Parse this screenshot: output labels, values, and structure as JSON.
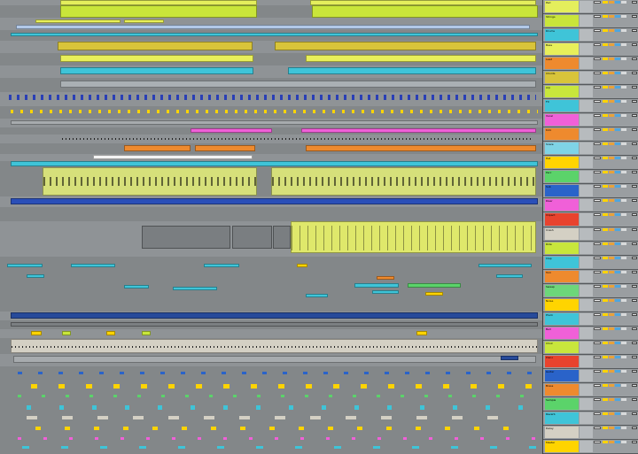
{
  "app": {
    "view": "arrangement",
    "colors": {
      "yellow_green": "#c8e63c",
      "lime": "#e8ef5a",
      "cyan": "#3fc4d8",
      "blue": "#2a63c9",
      "dark_blue": "#274a9a",
      "magenta": "#f060d8",
      "orange": "#ee8a2e",
      "gray_audio": "#7a7e81",
      "beige": "#d4d0c4",
      "green": "#5bd36a",
      "red": "#e8432e"
    }
  },
  "tracks": [
    {
      "name": "Pad",
      "color": "#e4ee5c"
    },
    {
      "name": "Strings",
      "color": "#c9e53a"
    },
    {
      "name": "Drums",
      "color": "#3fc4d8"
    },
    {
      "name": "Bass",
      "color": "#e8ef5a"
    },
    {
      "name": "Lead",
      "color": "#ee8a2e"
    },
    {
      "name": "Chords",
      "color": "#d8c43a"
    },
    {
      "name": "Arp",
      "color": "#c8e63c"
    },
    {
      "name": "FX",
      "color": "#3fc4d8"
    },
    {
      "name": "Vocal",
      "color": "#f060d8"
    },
    {
      "name": "Kick",
      "color": "#ee8a2e"
    },
    {
      "name": "Snare",
      "color": "#7fd3e6"
    },
    {
      "name": "Hat",
      "color": "#ffd400"
    },
    {
      "name": "Perc",
      "color": "#5bd36a"
    },
    {
      "name": "Sub",
      "color": "#2a63c9"
    },
    {
      "name": "Riser",
      "color": "#f060d8"
    },
    {
      "name": "Impact",
      "color": "#e8432e"
    },
    {
      "name": "Crash",
      "color": "#d4d0c4"
    },
    {
      "name": "Ride",
      "color": "#c8e63c"
    },
    {
      "name": "Clap",
      "color": "#3fc4d8"
    },
    {
      "name": "Tom",
      "color": "#ee8a2e"
    },
    {
      "name": "Sweep",
      "color": "#6dd67a"
    },
    {
      "name": "Noise",
      "color": "#ffd400"
    },
    {
      "name": "Pluck",
      "color": "#3fc4d8"
    },
    {
      "name": "Bell",
      "color": "#f060d8"
    },
    {
      "name": "Choir",
      "color": "#c8e63c"
    },
    {
      "name": "Piano",
      "color": "#e8432e"
    },
    {
      "name": "Guitar",
      "color": "#2a63c9"
    },
    {
      "name": "Brass",
      "color": "#ee8a2e"
    },
    {
      "name": "Sample",
      "color": "#5bd36a"
    },
    {
      "name": "Reverb",
      "color": "#3fc4d8"
    },
    {
      "name": "Delay",
      "color": "#d4d0c4"
    },
    {
      "name": "Master",
      "color": "#ffd400"
    }
  ]
}
